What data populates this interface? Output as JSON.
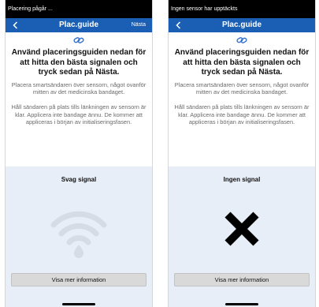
{
  "screens": [
    {
      "status_text": "Placering pågår ...",
      "title": "Plac.guide",
      "next_label": "Nästa",
      "heading": "Använd placeringsguiden nedan för att hitta den bästa signalen och tryck sedan på Nästa.",
      "instruction1": "Placera smartsändaren över sensorn, något ovanför mitten av det medicinska bandaget.",
      "instruction2": "Håll sändaren på plats tills länkningen av sensorn är klar. Applicera inte bandage ännu. De kommer att appliceras i början av initialiseringsfasen.",
      "signal_label": "Svag signal",
      "signal_icon": "weak-wifi-signal-icon",
      "info_button_label": "Visa mer information"
    },
    {
      "status_text": "Ingen sensor har upptäckts",
      "title": "Plac.guide",
      "next_label": "",
      "heading": "Använd placeringsguiden nedan för att hitta den bästa signalen och tryck sedan på Nästa.",
      "instruction1": "Placera smartsändaren över sensorn, något ovanför mitten av det medicinska bandaget.",
      "instruction2": "Håll sändaren på plats tills länkningen av sensorn är klar. Applicera inte bandage ännu. De kommer att appliceras i början av initialiseringsfasen.",
      "signal_label": "Ingen signal",
      "signal_icon": "no-signal-x-icon",
      "info_button_label": "Visa mer information"
    }
  ],
  "colors": {
    "navbar": "#1a5fb4",
    "status_bar": "#000000",
    "signal_area": "#e8eef7",
    "link_icon": "#2f6fce"
  }
}
